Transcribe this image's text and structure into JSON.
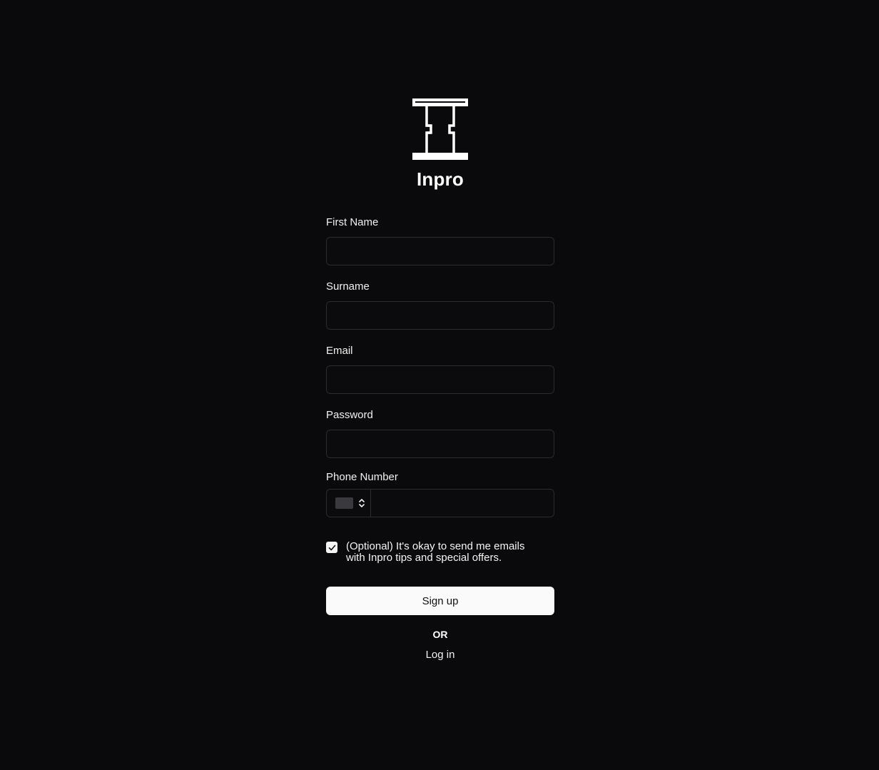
{
  "brand": {
    "name": "Inpro",
    "logo_icon": "pillar-logo-icon"
  },
  "form": {
    "first_name": {
      "label": "First Name",
      "value": "",
      "placeholder": ""
    },
    "surname": {
      "label": "Surname",
      "value": "",
      "placeholder": ""
    },
    "email": {
      "label": "Email",
      "value": "",
      "placeholder": ""
    },
    "password": {
      "label": "Password",
      "value": "",
      "placeholder": ""
    },
    "phone": {
      "label": "Phone Number",
      "value": "",
      "country_icon": "flag-placeholder-icon",
      "selector_icon": "chevron-updown-icon"
    },
    "consent": {
      "checked": true,
      "text": "(Optional) It's okay to send me emails with Inpro tips and special offers."
    },
    "submit_label": "Sign up",
    "or_text": "OR",
    "login_label": "Log in"
  },
  "colors": {
    "background": "#0a0a0c",
    "input_border": "#2b2b30",
    "button_bg": "#fafafa",
    "text": "#f5f5f5"
  }
}
